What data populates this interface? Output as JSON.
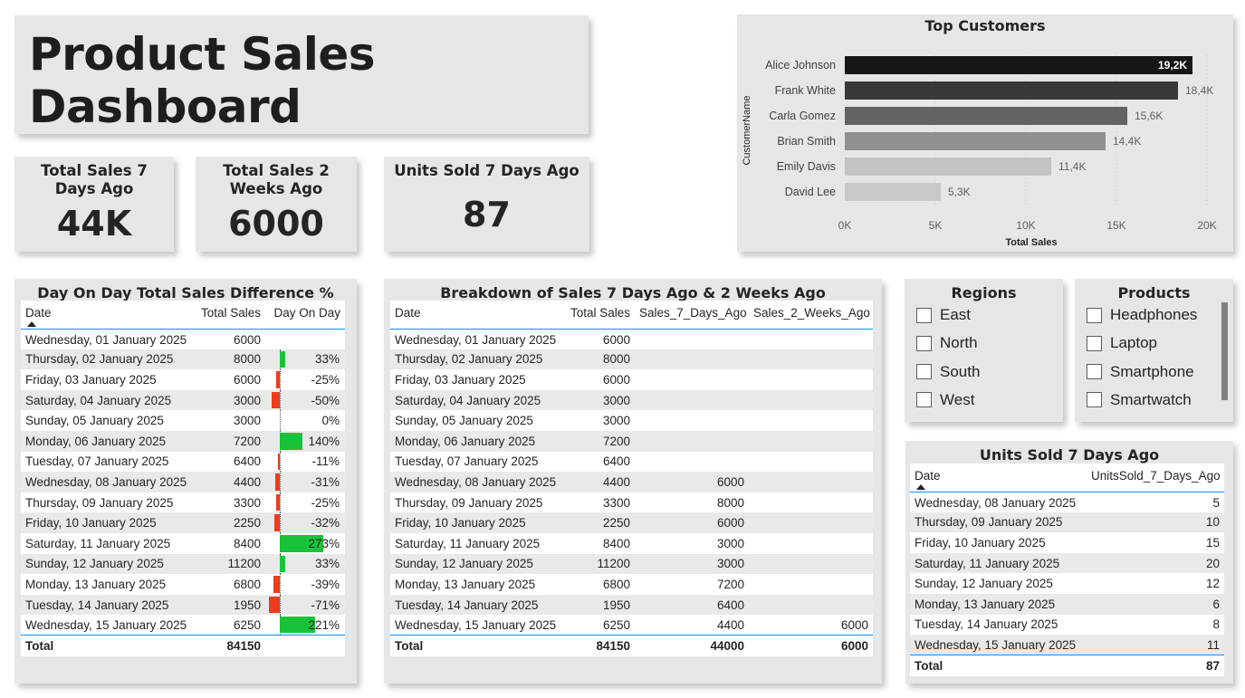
{
  "dashboard_title": "Product Sales Dashboard",
  "kpis": [
    {
      "title": "Total Sales 7 Days Ago",
      "value": "44K"
    },
    {
      "title": "Total Sales 2 Weeks Ago",
      "value": "6000"
    },
    {
      "title": "Units Sold 7 Days Ago",
      "value": "87"
    }
  ],
  "top_customers": {
    "title": "Top Customers",
    "chart_data": {
      "type": "bar",
      "orientation": "horizontal",
      "title": "Top Customers",
      "xlabel": "Total Sales",
      "ylabel": "CustomerName",
      "xlim": [
        0,
        20000
      ],
      "x_ticks": [
        "0K",
        "5K",
        "10K",
        "15K",
        "20K"
      ],
      "categories": [
        "Alice Johnson",
        "Frank White",
        "Carla Gomez",
        "Brian Smith",
        "Emily Davis",
        "David Lee"
      ],
      "values": [
        19200,
        18400,
        15600,
        14400,
        11400,
        5300
      ],
      "data_labels": [
        "19,2K",
        "18,4K",
        "15,6K",
        "14,4K",
        "11,4K",
        "5,3K"
      ],
      "colors": [
        "#161616",
        "#383838",
        "#636363",
        "#909090",
        "#c3c3c3",
        "#c8c8c8"
      ],
      "grid": true
    }
  },
  "dod_table": {
    "title": "Day On Day Total Sales Difference %",
    "columns": [
      "Date",
      "Total Sales",
      "Day On Day"
    ],
    "rows": [
      {
        "date": "Wednesday, 01 January 2025",
        "sales": "6000",
        "dod": "",
        "pct": null
      },
      {
        "date": "Thursday, 02 January 2025",
        "sales": "8000",
        "dod": "33%",
        "pct": 33
      },
      {
        "date": "Friday, 03 January 2025",
        "sales": "6000",
        "dod": "-25%",
        "pct": -25
      },
      {
        "date": "Saturday, 04 January 2025",
        "sales": "3000",
        "dod": "-50%",
        "pct": -50
      },
      {
        "date": "Sunday, 05 January 2025",
        "sales": "3000",
        "dod": "0%",
        "pct": 0
      },
      {
        "date": "Monday, 06 January 2025",
        "sales": "7200",
        "dod": "140%",
        "pct": 140
      },
      {
        "date": "Tuesday, 07 January 2025",
        "sales": "6400",
        "dod": "-11%",
        "pct": -11
      },
      {
        "date": "Wednesday, 08 January 2025",
        "sales": "4400",
        "dod": "-31%",
        "pct": -31
      },
      {
        "date": "Thursday, 09 January 2025",
        "sales": "3300",
        "dod": "-25%",
        "pct": -25
      },
      {
        "date": "Friday, 10 January 2025",
        "sales": "2250",
        "dod": "-32%",
        "pct": -32
      },
      {
        "date": "Saturday, 11 January 2025",
        "sales": "8400",
        "dod": "273%",
        "pct": 273
      },
      {
        "date": "Sunday, 12 January 2025",
        "sales": "11200",
        "dod": "33%",
        "pct": 33
      },
      {
        "date": "Monday, 13 January 2025",
        "sales": "6800",
        "dod": "-39%",
        "pct": -39
      },
      {
        "date": "Tuesday, 14 January 2025",
        "sales": "1950",
        "dod": "-71%",
        "pct": -71
      },
      {
        "date": "Wednesday, 15 January 2025",
        "sales": "6250",
        "dod": "221%",
        "pct": 221
      }
    ],
    "total_label": "Total",
    "total_sales": "84150",
    "positive_color": "#1ac23a",
    "negative_color": "#ef3b1c"
  },
  "breakdown_table": {
    "title": "Breakdown of Sales 7 Days Ago & 2 Weeks Ago",
    "columns": [
      "Date",
      "Total Sales",
      "Sales_7_Days_Ago",
      "Sales_2_Weeks_Ago"
    ],
    "rows": [
      [
        "Wednesday, 01 January 2025",
        "6000",
        "",
        ""
      ],
      [
        "Thursday, 02 January 2025",
        "8000",
        "",
        ""
      ],
      [
        "Friday, 03 January 2025",
        "6000",
        "",
        ""
      ],
      [
        "Saturday, 04 January 2025",
        "3000",
        "",
        ""
      ],
      [
        "Sunday, 05 January 2025",
        "3000",
        "",
        ""
      ],
      [
        "Monday, 06 January 2025",
        "7200",
        "",
        ""
      ],
      [
        "Tuesday, 07 January 2025",
        "6400",
        "",
        ""
      ],
      [
        "Wednesday, 08 January 2025",
        "4400",
        "6000",
        ""
      ],
      [
        "Thursday, 09 January 2025",
        "3300",
        "8000",
        ""
      ],
      [
        "Friday, 10 January 2025",
        "2250",
        "6000",
        ""
      ],
      [
        "Saturday, 11 January 2025",
        "8400",
        "3000",
        ""
      ],
      [
        "Sunday, 12 January 2025",
        "11200",
        "3000",
        ""
      ],
      [
        "Monday, 13 January 2025",
        "6800",
        "7200",
        ""
      ],
      [
        "Tuesday, 14 January 2025",
        "1950",
        "6400",
        ""
      ],
      [
        "Wednesday, 15 January 2025",
        "6250",
        "4400",
        "6000"
      ]
    ],
    "total": [
      "Total",
      "84150",
      "44000",
      "6000"
    ]
  },
  "regions": {
    "title": "Regions",
    "items": [
      "East",
      "North",
      "South",
      "West"
    ]
  },
  "products": {
    "title": "Products",
    "items": [
      "Headphones",
      "Laptop",
      "Smartphone",
      "Smartwatch"
    ]
  },
  "units_table": {
    "title": "Units Sold 7 Days Ago",
    "columns": [
      "Date",
      "UnitsSold_7_Days_Ago"
    ],
    "rows": [
      [
        "Wednesday, 08 January 2025",
        "5"
      ],
      [
        "Thursday, 09 January 2025",
        "10"
      ],
      [
        "Friday, 10 January 2025",
        "15"
      ],
      [
        "Saturday, 11 January 2025",
        "20"
      ],
      [
        "Sunday, 12 January 2025",
        "12"
      ],
      [
        "Monday, 13 January 2025",
        "6"
      ],
      [
        "Tuesday, 14 January 2025",
        "8"
      ],
      [
        "Wednesday, 15 January 2025",
        "11"
      ]
    ],
    "total": [
      "Total",
      "87"
    ]
  }
}
